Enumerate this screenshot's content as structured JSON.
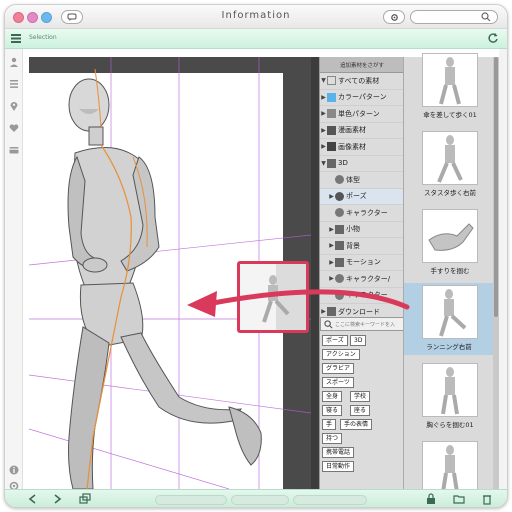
{
  "window": {
    "title": "Information",
    "accent": "#d93a5b"
  },
  "tabbar": {
    "label": "Selection"
  },
  "panel": {
    "header": "追加素材をさがす",
    "tree": [
      {
        "label": "すべての素材",
        "expand": "▼",
        "icon": "folder-icon"
      },
      {
        "label": "カラーパターン",
        "expand": "▶",
        "icon": "pattern-icon"
      },
      {
        "label": "単色パターン",
        "expand": "▶",
        "icon": "pattern-icon"
      },
      {
        "label": "漫画素材",
        "expand": "▶",
        "icon": "comic-icon"
      },
      {
        "label": "画像素材",
        "expand": "▶",
        "icon": "image-icon"
      },
      {
        "label": "3D",
        "expand": "▼",
        "icon": "cube-icon"
      },
      {
        "label": "体型",
        "expand": "",
        "icon": "body-icon"
      },
      {
        "label": "ポーズ",
        "expand": "▶",
        "icon": "pose-icon"
      },
      {
        "label": "キャラクター",
        "expand": "",
        "icon": "character-icon"
      },
      {
        "label": "小物",
        "expand": "▶",
        "icon": "object-icon"
      },
      {
        "label": "背景",
        "expand": "▶",
        "icon": "background-icon"
      },
      {
        "label": "モーション",
        "expand": "▶",
        "icon": "motion-icon"
      },
      {
        "label": "キャラクター/",
        "expand": "▶",
        "icon": "character-icon"
      },
      {
        "label": "キャラクター",
        "expand": "",
        "icon": "character-icon"
      },
      {
        "label": "ダウンロード",
        "expand": "▶",
        "icon": "download-icon"
      }
    ],
    "search_placeholder": "ここに検索キーワードを入"
  },
  "tags": [
    {
      "label": "ポーズ"
    },
    {
      "label": "3D"
    },
    {
      "label": "アクション"
    },
    {
      "label": "グラビア"
    },
    {
      "label": "スポーツ"
    },
    {
      "label": "全身"
    },
    {
      "label": "学校"
    },
    {
      "label": "寝る"
    },
    {
      "label": "座る"
    },
    {
      "label": "手"
    },
    {
      "label": "手の表情"
    },
    {
      "label": "持つ"
    },
    {
      "label": "携帯電話"
    },
    {
      "label": "日常動作"
    }
  ],
  "thumbnails": [
    {
      "caption": "傘を差して歩く01",
      "selected": false
    },
    {
      "caption": "スタスタ歩く右前",
      "selected": false
    },
    {
      "caption": "手すりを掴む",
      "selected": false
    },
    {
      "caption": "ランニング右前",
      "selected": true
    },
    {
      "caption": "胸ぐらを掴む01",
      "selected": false
    },
    {
      "caption": "",
      "selected": false
    }
  ]
}
